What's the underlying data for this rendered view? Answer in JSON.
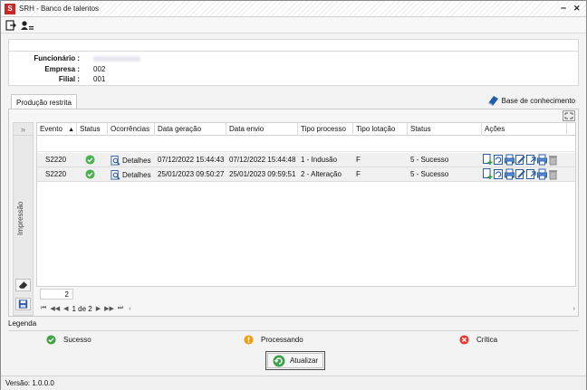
{
  "window": {
    "title": "SRH - Banco de talentos",
    "minimize": "–",
    "close": "✕"
  },
  "toolbar": {
    "icons": [
      "exit-icon",
      "user-card-icon"
    ]
  },
  "info": {
    "funcionario_label": "Funcionário :",
    "empresa_label": "Empresa :",
    "empresa_value": "002",
    "filial_label": "Filial :",
    "filial_value": "001"
  },
  "tabs": [
    {
      "label": "Produção restrita",
      "active": true
    }
  ],
  "knowledge_base": {
    "label": "Base de conhecimento"
  },
  "sidebar": {
    "label": "Impressão",
    "expand": "»"
  },
  "grid": {
    "columns": [
      "Evento",
      "Status",
      "Ocorrências",
      "Data geração",
      "Data envio",
      "Tipo processo",
      "Tipo lotação",
      "Status",
      "Ações"
    ],
    "sort_indicator": "▲",
    "rows": [
      {
        "evento": "S2220",
        "status_icon": "check-circle-icon",
        "ocorrencias": "Detalhes",
        "data_geracao": "07/12/2022 15:44:43",
        "data_envio": "07/12/2022 15:44:48",
        "tipo_processo": "1 - Indusão",
        "tipo_lotacao": "F",
        "status": "5 - Sucesso"
      },
      {
        "evento": "S2220",
        "status_icon": "check-circle-icon",
        "ocorrencias": "Detalhes",
        "data_geracao": "25/01/2023 09:50:27",
        "data_envio": "25/01/2023 09:59:51",
        "tipo_processo": "2 - Alteração",
        "tipo_lotacao": "F",
        "status": "5 - Sucesso"
      }
    ],
    "row_count": "2"
  },
  "pager": {
    "first": "⏮",
    "prev_page": "◀◀",
    "prev": "◀",
    "page_text": "1 de 2",
    "next": "▶",
    "next_page": "▶▶",
    "last": "⏭",
    "scroll_left": "‹",
    "scroll_right": "›"
  },
  "legend": {
    "title": "Legenda",
    "items": [
      {
        "label": "Sucesso",
        "color": "#43a047"
      },
      {
        "label": "Processando",
        "color": "#f39c12"
      },
      {
        "label": "Crítica",
        "color": "#e53935"
      }
    ]
  },
  "actions": {
    "refresh_label": "Atualizar"
  },
  "status_bar": {
    "version": "Versão:  1.0.0.0"
  }
}
